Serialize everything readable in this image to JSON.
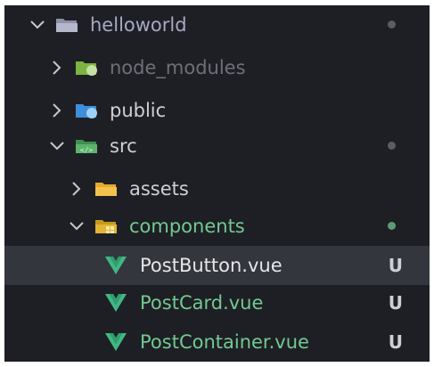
{
  "colors": {
    "panel_bg": "#1e1f25",
    "selected_bg": "#34363d",
    "text_default": "#cfd0d6",
    "text_dim": "#6d7079",
    "text_green": "#73c991",
    "vue_green": "#41b883",
    "folder_gray": "#9aa0b0",
    "folder_yellow": "#e8b23a",
    "folder_blue": "#4aa3e8",
    "folder_green_node": "#8bc34a",
    "dot_gray": "#5a5d66",
    "dot_green": "#5e9b73",
    "badge_color": "#cfd0d6"
  },
  "tree": [
    {
      "name": "helloworld",
      "type": "folder",
      "expanded": true,
      "depth": 0,
      "icon": "folder-open-icon",
      "color": "#a7a9c2",
      "dot": "gray"
    },
    {
      "name": "node_modules",
      "type": "folder",
      "expanded": false,
      "depth": 1,
      "icon": "folder-node-icon",
      "color": "#6d7079"
    },
    {
      "name": "public",
      "type": "folder",
      "expanded": false,
      "depth": 1,
      "icon": "folder-public-icon",
      "color": "#cfd0d6"
    },
    {
      "name": "src",
      "type": "folder",
      "expanded": true,
      "depth": 1,
      "icon": "folder-src-icon",
      "color": "#cfd0d6",
      "dot": "gray"
    },
    {
      "name": "assets",
      "type": "folder",
      "expanded": false,
      "depth": 2,
      "icon": "folder-assets-icon",
      "color": "#cfd0d6"
    },
    {
      "name": "components",
      "type": "folder",
      "expanded": true,
      "depth": 2,
      "icon": "folder-components-icon",
      "color": "#73c991",
      "dot": "green"
    },
    {
      "name": "PostButton.vue",
      "type": "file",
      "depth": 3,
      "icon": "vue-icon",
      "color": "#e6e6ea",
      "badge": "U",
      "selected": true
    },
    {
      "name": "PostCard.vue",
      "type": "file",
      "depth": 3,
      "icon": "vue-icon",
      "color": "#73c991",
      "badge": "U"
    },
    {
      "name": "PostContainer.vue",
      "type": "file",
      "depth": 3,
      "icon": "vue-icon",
      "color": "#73c991",
      "badge": "U"
    }
  ]
}
